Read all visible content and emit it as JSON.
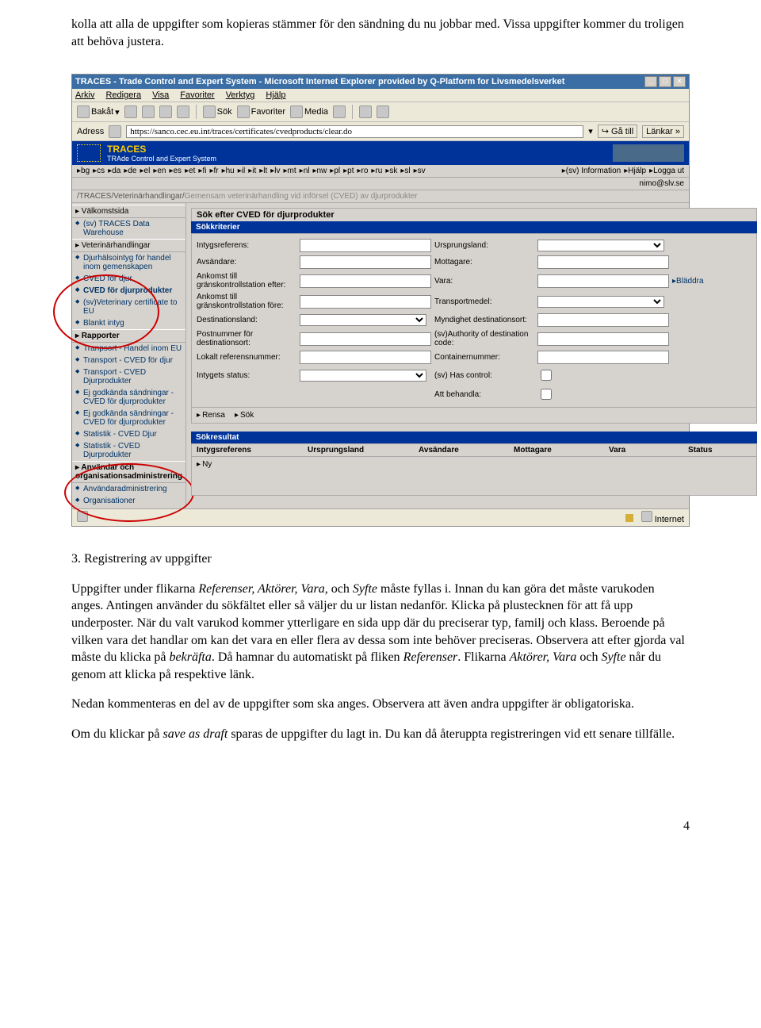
{
  "intro": "kolla att alla de uppgifter som kopieras stämmer för den sändning du nu jobbar med. Vissa uppgifter kommer du troligen att behöva justera.",
  "section3": {
    "title": "3. Registrering av uppgifter",
    "p1a": "Uppgifter under flikarna ",
    "p1b": "Referenser, Aktörer, Vara",
    "p1c": ", och ",
    "p1d": "Syfte",
    "p1e": " måste fyllas i. Innan du kan göra det måste varukoden anges. Antingen använder du sökfältet eller så väljer du ur listan nedanför. Klicka på plustecknen för att få upp underposter. När du valt varukod kommer ytterligare en sida upp där du preciserar typ, familj och klass. Beroende på vilken vara det handlar om kan det vara en eller flera av dessa som inte behöver preciseras. Observera att efter gjorda val måste du klicka på ",
    "p1f": "bekräfta",
    "p1g": ". Då hamnar du automatiskt på fliken ",
    "p1h": "Referenser",
    "p1i": ". Flikarna ",
    "p1j": "Aktörer, Vara",
    "p1k": " och ",
    "p1l": "Syfte",
    "p1m": " når du genom att klicka på respektive länk.",
    "p2": "Nedan kommenteras en del av de uppgifter som ska anges. Observera att även andra uppgifter är obligatoriska.",
    "p3a": "Om du klickar på ",
    "p3b": "save as draft",
    "p3c": " sparas de uppgifter du lagt in. Du kan då återuppta registreringen vid ett senare tillfälle."
  },
  "pagenum": "4",
  "ie": {
    "title": "TRACES - Trade Control and Expert System - Microsoft Internet Explorer provided by Q-Platform for Livsmedelsverket",
    "menu": [
      "Arkiv",
      "Redigera",
      "Visa",
      "Favoriter",
      "Verktyg",
      "Hjälp"
    ],
    "back": "Bakåt",
    "search": "Sök",
    "fav": "Favoriter",
    "media": "Media",
    "addr_label": "Adress",
    "addr": "https://sanco.cec.eu.int/traces/certificates/cvedproducts/clear.do",
    "go": "Gå till",
    "links": "Länkar",
    "status_right": "Internet"
  },
  "traces": {
    "brand": "TRACES",
    "brand_sub": "TRAde Control and Expert System",
    "langs": [
      "▸bg",
      "▸cs",
      "▸da",
      "▸de",
      "▸el",
      "▸en",
      "▸es",
      "▸et",
      "▸fi",
      "▸fr",
      "▸hu",
      "▸il",
      "▸it",
      "▸lt",
      "▸lv",
      "▸mt",
      "▸nl",
      "▸nw",
      "▸pl",
      "▸pt",
      "▸ro",
      "▸ru",
      "▸sk",
      "▸sl",
      "▸sv"
    ],
    "topright": [
      "▸(sv) Information",
      "▸Hjälp",
      "▸Logga ut"
    ],
    "user": "nimo@slv.se",
    "crumb1": "/TRACES/Veterinärhandlingar/",
    "crumb2": "Gemensam veterinärhandling vid införsel (CVED) av djurprodukter",
    "nav": {
      "h1": "▸ Välkomstsida",
      "i1": "(sv) TRACES Data Warehouse",
      "h2": "▸ Veterinärhandlingar",
      "i2": "Djurhälsointyg för handel inom gemenskapen",
      "i3": "CVED för djur",
      "i4": "CVED för djurprodukter",
      "i5": "(sv)Veterinary certificate to EU",
      "i6": "Blankt intyg",
      "h3": "▸ Rapporter",
      "i7": "Tranpsort - Handel inom EU",
      "i8": "Transport - CVED för djur",
      "i9": "Transport - CVED Djurprodukter",
      "i10": "Ej godkända sändningar - CVED för djurprodukter",
      "i11": "Ej godkända sändningar - CVED för djurprodukter",
      "i12": "Statistik - CVED Djur",
      "i13": "Statistik - CVED Djurprodukter",
      "h4": "▸ Användar och organisationsadministrering",
      "i14": "Användaradministrering",
      "i15": "Organisationer"
    },
    "panel": {
      "title": "Sök efter CVED för djurprodukter",
      "sub": "Sökkriterier",
      "f": {
        "l1": "Intygsreferens:",
        "l2": "Ursprungsland:",
        "l3": "Avsändare:",
        "l4": "Mottagare:",
        "l5": "Ankomst till gränskontrollstation efter:",
        "l6": "Vara:",
        "browse": "▸Bläddra",
        "l7": "Ankomst till gränskontrollstation före:",
        "l8": "Transportmedel:",
        "l9": "Destinationsland:",
        "l10": "Myndighet destinationsort:",
        "l11": "Postnummer för destinationsort:",
        "l12": "(sv)Authority of destination code:",
        "l13": "Lokalt referensnummer:",
        "l14": "Containernummer:",
        "l15": "Intygets status:",
        "l16": "(sv) Has control:",
        "l17": "Att behandla:"
      },
      "actions": {
        "rensa": "Rensa",
        "sok": "Sök"
      },
      "res_title": "Sökresultat",
      "cols": [
        "Intygsreferens",
        "Ursprungsland",
        "Avsändare",
        "Mottagare",
        "Vara",
        "Status"
      ],
      "ny": "Ny"
    }
  }
}
